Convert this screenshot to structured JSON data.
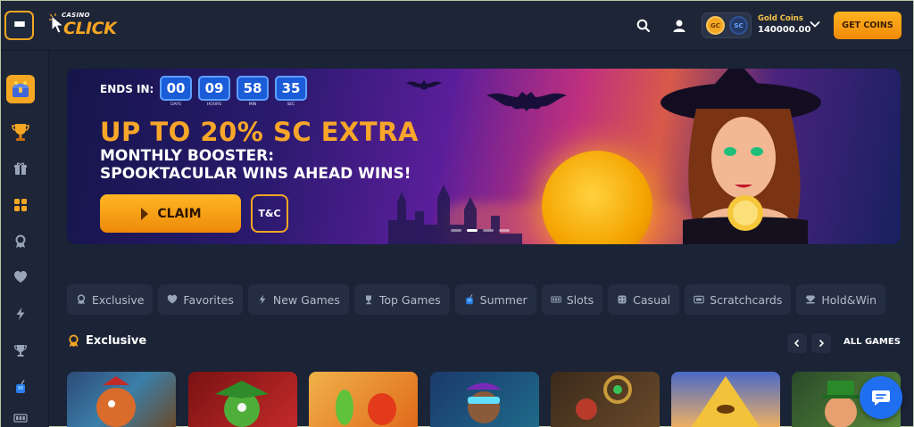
{
  "header": {
    "logo_small": "CASINO",
    "logo_big": "CLICK",
    "balance_label": "Gold Coins",
    "balance_value": "140000.00",
    "gc_label": "GC",
    "sc_label": "SC",
    "get_coins_label": "GET COINS"
  },
  "sidebar": {
    "items": [
      {
        "icon": "promo-chest-icon"
      },
      {
        "icon": "trophy-icon"
      },
      {
        "icon": "gift-icon"
      },
      {
        "icon": "grid-icon"
      },
      {
        "icon": "badge-icon"
      },
      {
        "icon": "heart-icon"
      },
      {
        "icon": "lightning-icon"
      },
      {
        "icon": "cup-icon"
      },
      {
        "icon": "drink-icon"
      }
    ]
  },
  "banner": {
    "ends_in": "ENDS IN:",
    "timer": [
      {
        "value": "00",
        "label": "DAYS"
      },
      {
        "value": "09",
        "label": "HOURS"
      },
      {
        "value": "58",
        "label": "MIN"
      },
      {
        "value": "35",
        "label": "SEC"
      }
    ],
    "headline": "UP TO 20% SC EXTRA",
    "sub1": "MONTHLY BOOSTER:",
    "sub2": "SPOOKTACULAR WINS AHEAD WINS!",
    "claim_label": "CLAIM",
    "tc_label": "T&C",
    "slides": 4,
    "active_slide": 2
  },
  "categories": [
    {
      "label": "Exclusive",
      "icon": "badge-icon"
    },
    {
      "label": "Favorites",
      "icon": "heart-icon"
    },
    {
      "label": "New Games",
      "icon": "lightning-icon"
    },
    {
      "label": "Top Games",
      "icon": "trophy-icon"
    },
    {
      "label": "Summer",
      "icon": "drink-icon"
    },
    {
      "label": "Slots",
      "icon": "slots-icon"
    },
    {
      "label": "Casual",
      "icon": "dice-icon"
    },
    {
      "label": "Scratchcards",
      "icon": "ticket-icon"
    },
    {
      "label": "Hold&Win",
      "icon": "diamond-hand-icon"
    }
  ],
  "section": {
    "title": "Exclusive",
    "all_games": "ALL GAMES"
  },
  "colors": {
    "accent": "#f5a623",
    "background": "#1b2336",
    "panel": "#242d42",
    "timer_blue": "#1b5cd8",
    "chat_blue": "#1f6ff0"
  }
}
